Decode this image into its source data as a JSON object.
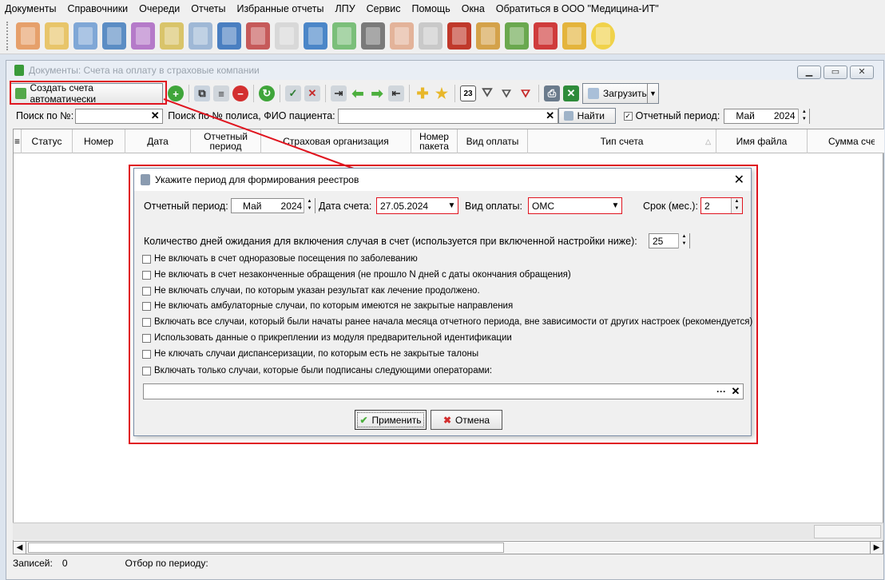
{
  "menu": [
    "Документы",
    "Справочники",
    "Очереди",
    "Отчеты",
    "Избранные отчеты",
    "ЛПУ",
    "Сервис",
    "Помощь",
    "Окна",
    "Обратиться в ООО \"Медицина-ИТ\""
  ],
  "window": {
    "title": "Документы: Счета на оплату в страховые компании"
  },
  "toolbar": {
    "create_auto_label": "Создать счета автоматически",
    "upload_label": "Загрузить"
  },
  "search": {
    "by_number_label": "Поиск по №:",
    "by_policy_label": "Поиск по № полиса, ФИО пациента:",
    "find_label": "Найти",
    "period_label": "Отчетный период:",
    "period_month": "Май",
    "period_year": "2024"
  },
  "grid": {
    "columns": [
      "Статус",
      "Номер",
      "Дата",
      "Отчетный период",
      "Страховая организация",
      "Номер пакета",
      "Вид оплаты",
      "Тип счета",
      "Имя файла",
      "Сумма сче"
    ]
  },
  "status": {
    "records_label": "Записей:",
    "records_value": "0",
    "filter_label": "Отбор по периоду:"
  },
  "dialog": {
    "title": "Укажите период для формирования реестров",
    "period_label": "Отчетный период:",
    "period_month": "Май",
    "period_year": "2024",
    "invoice_date_label": "Дата счета:",
    "invoice_date": "27.05.2024",
    "payment_type_label": "Вид оплаты:",
    "payment_type": "ОМС",
    "term_label": "Срок (мес.):",
    "term": "2",
    "wait_days_label": "Количество дней ожидания для включения случая в счет (используется при включенной настройки ниже):",
    "wait_days": "25",
    "options": [
      "Не включать в счет одноразовые посещения по заболеванию",
      "Не включать в счет незаконченные обращения (не прошло N дней с даты окончания обращения)",
      "Не включать случаи, по которым указан результат как лечение продолжено.",
      "Не включать амбулаторные случаи, по которым имеются не закрытые направления",
      "Включать все случаи, который были начаты ранее начала месяца отчетного периода, вне зависимости от других настроек (рекомендуется)",
      "Использовать данные о прикреплении из модуля предварительной идентификации",
      "Не ключать случаи диспансеризации, по которым есть не закрытые талоны",
      "Включать только случаи, которые были подписаны следующими операторами:"
    ],
    "apply_label": "Применить",
    "cancel_label": "Отмена"
  },
  "colors": {
    "highlight": "#e0141f",
    "accent_green": "#4caf3d"
  }
}
